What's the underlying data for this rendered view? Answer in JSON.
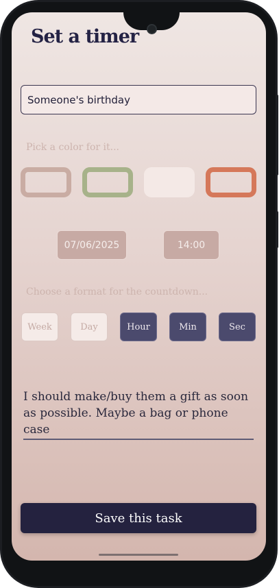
{
  "header": {
    "title": "Set a timer"
  },
  "task_name": {
    "value": "Someone's birthday",
    "placeholder": ""
  },
  "color_section": {
    "hint": "Pick a color for it...",
    "swatches": [
      {
        "name": "beige",
        "color": "#c9aca3",
        "style": "outline"
      },
      {
        "name": "green",
        "color": "#a7b28a",
        "style": "outline"
      },
      {
        "name": "cream",
        "color": "#f4e9e6",
        "style": "filled"
      },
      {
        "name": "orange",
        "color": "#d5785a",
        "style": "outline"
      }
    ]
  },
  "datetime": {
    "date": "07/06/2025",
    "time": "14:00"
  },
  "format_section": {
    "hint": "Choose a format for the countdown...",
    "options": [
      {
        "label": "Week",
        "selected": false
      },
      {
        "label": "Day",
        "selected": false
      },
      {
        "label": "Hour",
        "selected": true
      },
      {
        "label": "Min",
        "selected": true
      },
      {
        "label": "Sec",
        "selected": true
      }
    ]
  },
  "note": {
    "value": "I should make/buy them a gift as soon as possible. Maybe a bag or phone case"
  },
  "save": {
    "label": "Save this task"
  },
  "colors": {
    "primary": "#24223f",
    "selected_format": "#4b4a6d",
    "hint_text": "#cdb4ae"
  }
}
